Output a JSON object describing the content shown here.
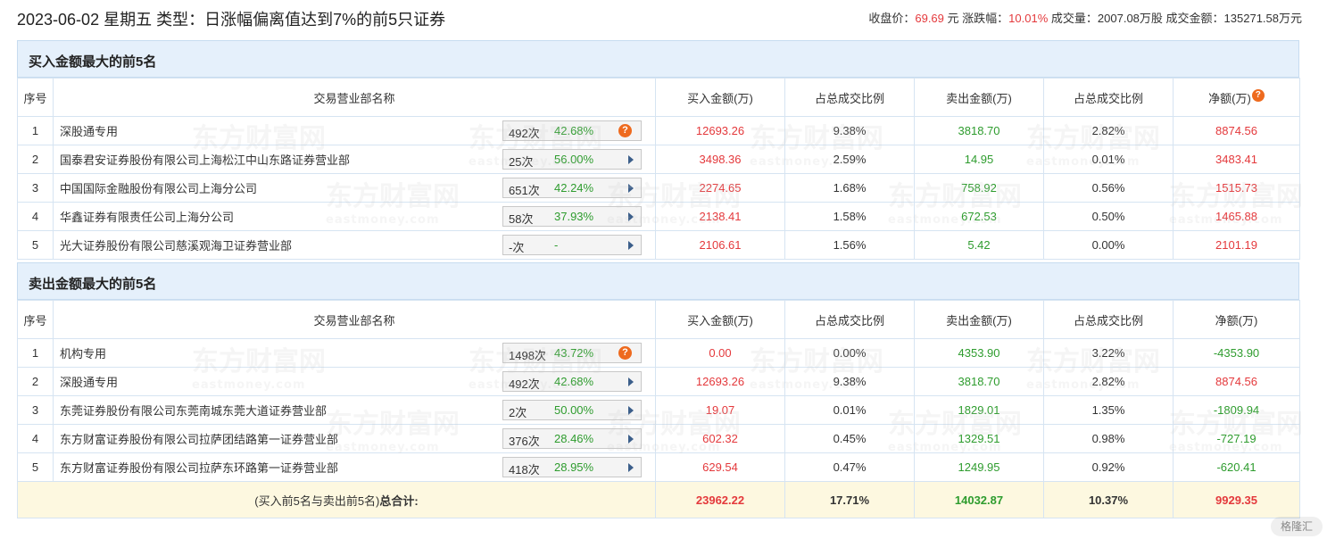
{
  "header": {
    "title": "2023-06-02 星期五 类型：日涨幅偏离值达到7%的前5只证券",
    "close_label": "收盘价：",
    "close_value": "69.69",
    "close_unit": " 元",
    "change_label": "涨跌幅：",
    "change_value": "10.01%",
    "volume_label": "成交量：",
    "volume_value": "2007.08万股",
    "amount_label": "成交金额：",
    "amount_value": "135271.58万元"
  },
  "columns": [
    "序号",
    "交易营业部名称",
    "买入金额(万)",
    "占总成交比例",
    "卖出金额(万)",
    "占总成交比例",
    "净额(万)"
  ],
  "help_mark": "?",
  "watermark": {
    "cn": "东方财富网",
    "en": "eastmoney.com"
  },
  "buy_section": {
    "title": "买入金额最大的前5名",
    "rows": [
      {
        "idx": "1",
        "name": "深股通专用",
        "count": "492次",
        "rate": "42.68%",
        "buy": "12693.26",
        "buy_pct": "9.38%",
        "sell": "3818.70",
        "sell_pct": "2.82%",
        "net": "8874.56"
      },
      {
        "idx": "2",
        "name": "国泰君安证券股份有限公司上海松江中山东路证券营业部",
        "count": "25次",
        "rate": "56.00%",
        "buy": "3498.36",
        "buy_pct": "2.59%",
        "sell": "14.95",
        "sell_pct": "0.01%",
        "net": "3483.41"
      },
      {
        "idx": "3",
        "name": "中国国际金融股份有限公司上海分公司",
        "count": "651次",
        "rate": "42.24%",
        "buy": "2274.65",
        "buy_pct": "1.68%",
        "sell": "758.92",
        "sell_pct": "0.56%",
        "net": "1515.73"
      },
      {
        "idx": "4",
        "name": "华鑫证券有限责任公司上海分公司",
        "count": "58次",
        "rate": "37.93%",
        "buy": "2138.41",
        "buy_pct": "1.58%",
        "sell": "672.53",
        "sell_pct": "0.50%",
        "net": "1465.88"
      },
      {
        "idx": "5",
        "name": "光大证券股份有限公司慈溪观海卫证券营业部",
        "count": "-次",
        "rate": "-",
        "buy": "2106.61",
        "buy_pct": "1.56%",
        "sell": "5.42",
        "sell_pct": "0.00%",
        "net": "2101.19"
      }
    ]
  },
  "sell_section": {
    "title": "卖出金额最大的前5名",
    "rows": [
      {
        "idx": "1",
        "name": "机构专用",
        "count": "1498次",
        "rate": "43.72%",
        "buy": "0.00",
        "buy_pct": "0.00%",
        "sell": "4353.90",
        "sell_pct": "3.22%",
        "net": "-4353.90"
      },
      {
        "idx": "2",
        "name": "深股通专用",
        "count": "492次",
        "rate": "42.68%",
        "buy": "12693.26",
        "buy_pct": "9.38%",
        "sell": "3818.70",
        "sell_pct": "2.82%",
        "net": "8874.56"
      },
      {
        "idx": "3",
        "name": "东莞证券股份有限公司东莞南城东莞大道证券营业部",
        "count": "2次",
        "rate": "50.00%",
        "buy": "19.07",
        "buy_pct": "0.01%",
        "sell": "1829.01",
        "sell_pct": "1.35%",
        "net": "-1809.94"
      },
      {
        "idx": "4",
        "name": "东方财富证券股份有限公司拉萨团结路第一证券营业部",
        "count": "376次",
        "rate": "28.46%",
        "buy": "602.32",
        "buy_pct": "0.45%",
        "sell": "1329.51",
        "sell_pct": "0.98%",
        "net": "-727.19"
      },
      {
        "idx": "5",
        "name": "东方财富证券股份有限公司拉萨东环路第一证券营业部",
        "count": "418次",
        "rate": "28.95%",
        "buy": "629.54",
        "buy_pct": "0.47%",
        "sell": "1249.95",
        "sell_pct": "0.92%",
        "net": "-620.41"
      }
    ]
  },
  "total": {
    "label_prefix": "(买入前5名与卖出前5名)",
    "label_bold": "总合计:",
    "buy": "23962.22",
    "buy_pct": "17.71%",
    "sell": "14032.87",
    "sell_pct": "10.37%",
    "net": "9929.35"
  },
  "corner_badge": "格隆汇",
  "colors": {
    "positive": "#e4393c",
    "negative": "#2e9c2e",
    "header_bg": "#e5f0fb",
    "total_bg": "#fdf8e0"
  }
}
